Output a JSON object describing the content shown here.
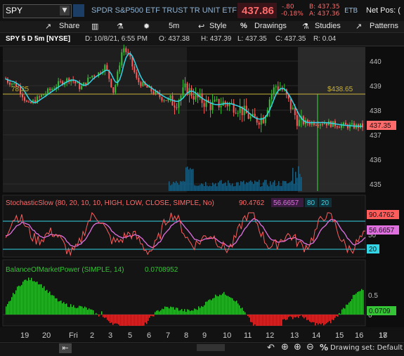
{
  "quote": {
    "symbol": "SPY",
    "description": "SPDR S&P500 ETF TRUST TR UNIT ETF",
    "last": "437.86",
    "change": "-.80",
    "change_pct": "-0.18%",
    "bid": "B: 437.35",
    "ask": "A: 437.36",
    "exchange": "ETB",
    "net_pos_label": "Net Pos: ("
  },
  "toolbar": {
    "share": "Share",
    "interval": "5m",
    "style": "Style",
    "drawings": "Drawings",
    "studies": "Studies",
    "patterns": "Patterns"
  },
  "chart_header": {
    "title": "SPY 5 D 5m [NYSE]",
    "date": "D: 10/8/21, 6:55 PM",
    "open": "O: 437.38",
    "high": "H: 437.39",
    "low": "L: 437.35",
    "close": "C: 437.35",
    "range": "R: 0.04"
  },
  "price_panel": {
    "left_level": "78.25",
    "right_level": "$438.65",
    "current_badge": "437.35",
    "yticks": [
      "440",
      "439",
      "438",
      "437",
      "436",
      "435"
    ],
    "colors": {
      "up": "#35c435",
      "down": "#ff5c5c",
      "avg": "#33d6e6",
      "level": "#c9b23a"
    }
  },
  "stoch": {
    "label": "StochasticSlow (80, 20, 10, 10, HIGH, LOW, CLOSE, SIMPLE, No)",
    "k": "90.4762",
    "d": "56.6657",
    "ob": "80",
    "os": "20",
    "badge_k": "90.4762",
    "badge_d": "56.6657",
    "badge_os": "20",
    "yticks": [
      "50"
    ]
  },
  "bop": {
    "label": "BalanceOfMarketPower (SIMPLE, 14)",
    "value": "0.0708952",
    "badge": "0.0709",
    "yticks": [
      "0.5",
      "0"
    ]
  },
  "x_axis": [
    "19",
    "20",
    "Fri",
    "2",
    "3",
    "5",
    "6",
    "7",
    "8",
    "9",
    "10",
    "11",
    "12",
    "13",
    "14",
    "15",
    "16",
    "17",
    "18"
  ],
  "status": {
    "drawing_set": "Drawing set: Default"
  }
}
